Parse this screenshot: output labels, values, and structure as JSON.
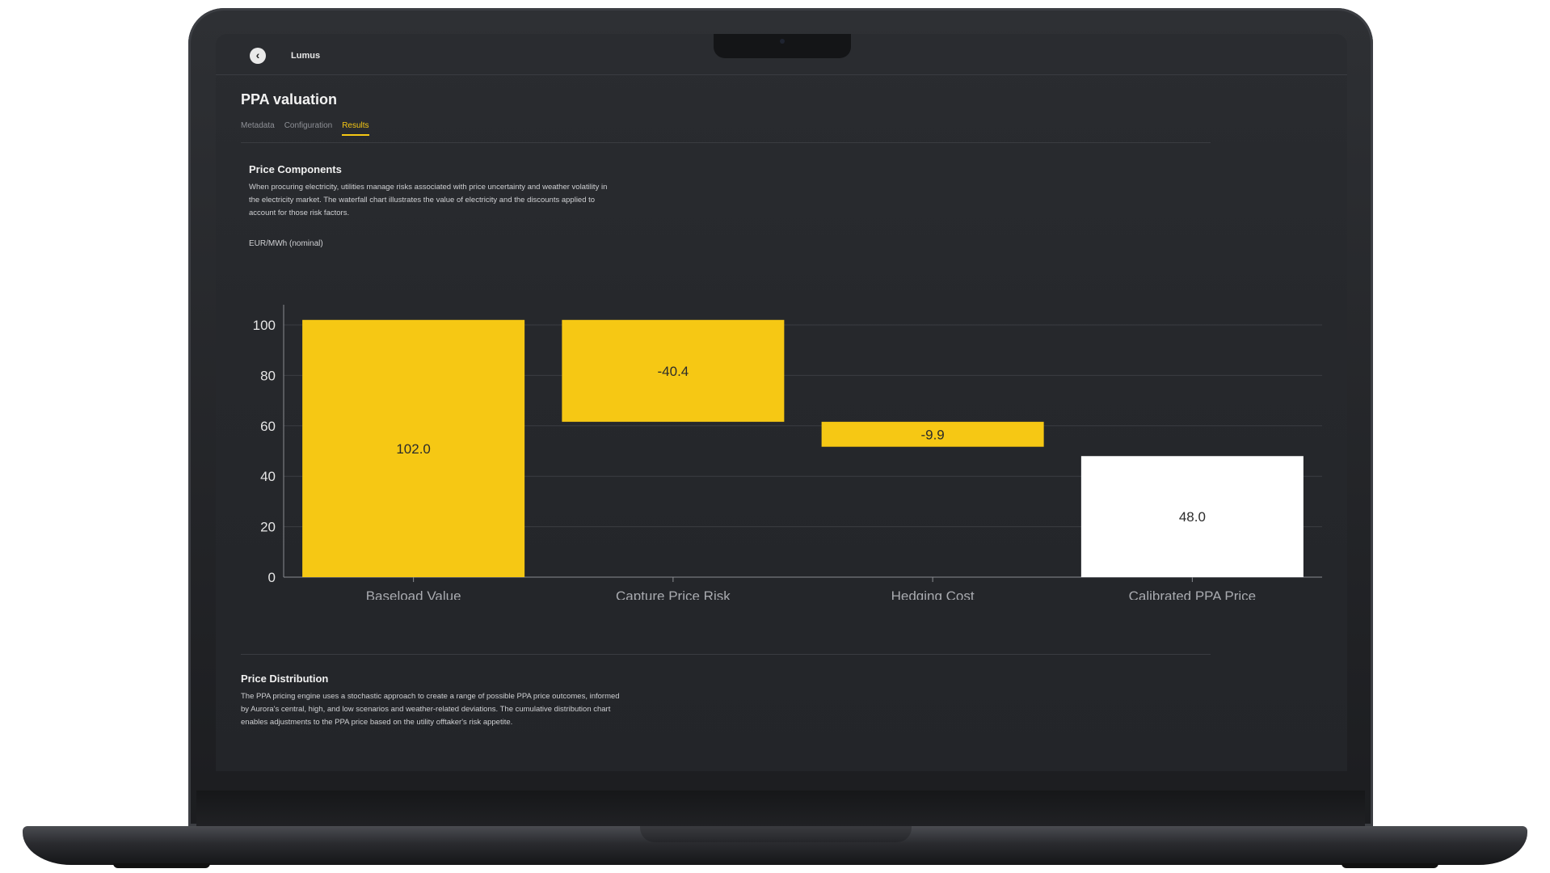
{
  "app": {
    "name": "Lumus"
  },
  "page": {
    "title": "PPA valuation",
    "tabs": [
      {
        "label": "Metadata",
        "active": false
      },
      {
        "label": "Configuration",
        "active": false
      },
      {
        "label": "Results",
        "active": true
      }
    ]
  },
  "price_components": {
    "title": "Price Components",
    "description": "When procuring electricity, utilities manage risks associated with price uncertainty and weather volatility in the electricity market. The waterfall chart illustrates the value of electricity and the discounts applied to account for those risk factors.",
    "unit": "EUR/MWh (nominal)"
  },
  "price_distribution": {
    "title": "Price Distribution",
    "description": "The PPA pricing engine uses a stochastic approach to create a range of possible PPA price outcomes, informed by Aurora's central, high, and low scenarios and weather-related deviations. The cumulative distribution chart enables adjustments to the PPA price based on the utility offtaker's risk appetite."
  },
  "colors": {
    "accent": "#f6c814",
    "total_bar": "#ffffff",
    "screen_bg": "#26282c"
  },
  "chart_data": {
    "type": "bar",
    "subtype": "waterfall",
    "categories": [
      "Baseload Value",
      "Capture Price Risk",
      "Hedging Cost",
      "Calibrated PPA Price"
    ],
    "values": [
      102.0,
      -40.4,
      -9.9,
      48.0
    ],
    "labels": [
      "102.0",
      "-40.4",
      "-9.9",
      "48.0"
    ],
    "measures": [
      "absolute",
      "relative",
      "relative",
      "total"
    ],
    "bar_colors": [
      "#f6c814",
      "#f6c814",
      "#f6c814",
      "#ffffff"
    ],
    "xlabel": "Price Components",
    "ylabel": "",
    "yticks": [
      0,
      20,
      40,
      60,
      80,
      100
    ],
    "ylim": [
      0,
      108
    ],
    "grid": true
  }
}
